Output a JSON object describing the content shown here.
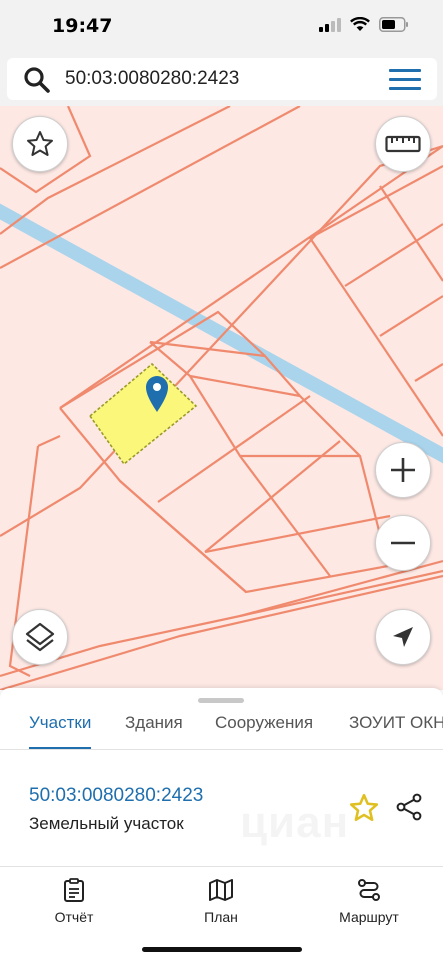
{
  "status_bar": {
    "time": "19:47"
  },
  "search": {
    "value": "50:03:0080280:2423"
  },
  "tabs": [
    {
      "label": "Участки",
      "active": true
    },
    {
      "label": "Здания",
      "active": false
    },
    {
      "label": "Сооружения",
      "active": false
    },
    {
      "label": "ЗОУИТ ОКН",
      "active": false
    }
  ],
  "result": {
    "cadastral_number": "50:03:0080280:2423",
    "type": "Земельный участок"
  },
  "watermark": "циан",
  "bottom_nav": [
    {
      "label": "Отчёт",
      "icon": "report-icon"
    },
    {
      "label": "План",
      "icon": "map-plan-icon"
    },
    {
      "label": "Маршрут",
      "icon": "route-icon"
    }
  ],
  "colors": {
    "accent": "#1f6fae",
    "map_background": "#fde8e4",
    "parcel_border": "#f08a6e",
    "selected_parcel": "#fbf77a",
    "road": "#a9d4ec",
    "favorite_star": "#e0c020"
  }
}
